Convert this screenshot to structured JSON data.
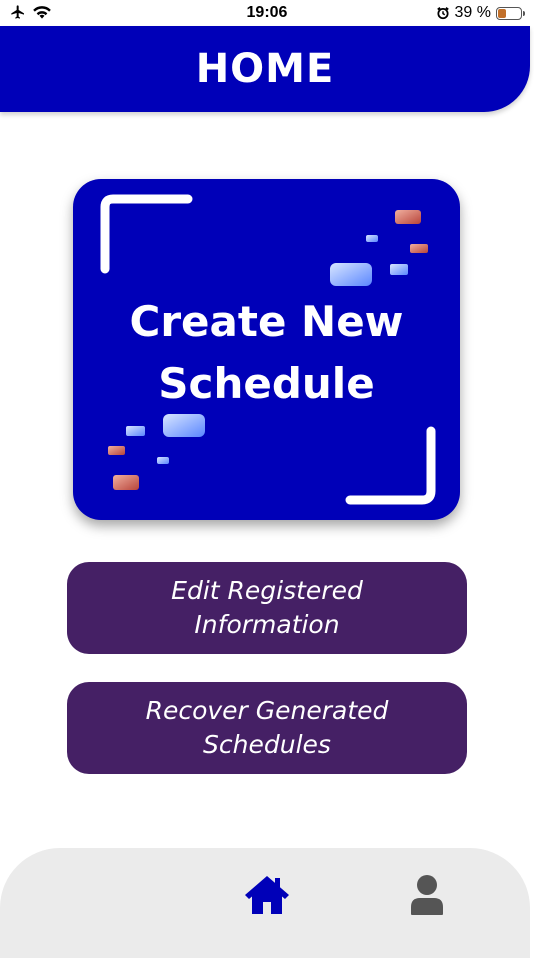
{
  "status_bar": {
    "time": "19:06",
    "battery_percent": "39 %",
    "battery_level": 0.39,
    "icons": [
      "airplane-icon",
      "wifi-icon",
      "alarm-icon",
      "battery-icon"
    ]
  },
  "header": {
    "title": "HOME"
  },
  "create_card": {
    "line1": "Create New",
    "line2": "Schedule"
  },
  "buttons": {
    "edit_line1": "Edit Registered",
    "edit_line2": "Information",
    "recover_line1": "Recover Generated",
    "recover_line2": "Schedules"
  },
  "bottom_nav": {
    "items": [
      {
        "icon": "home-icon",
        "active": true
      },
      {
        "icon": "profile-icon",
        "active": false
      }
    ]
  },
  "colors": {
    "primary_blue": "#0000b8",
    "button_purple": "#452065",
    "nav_background": "#ebebeb",
    "inactive_icon": "#555555"
  }
}
